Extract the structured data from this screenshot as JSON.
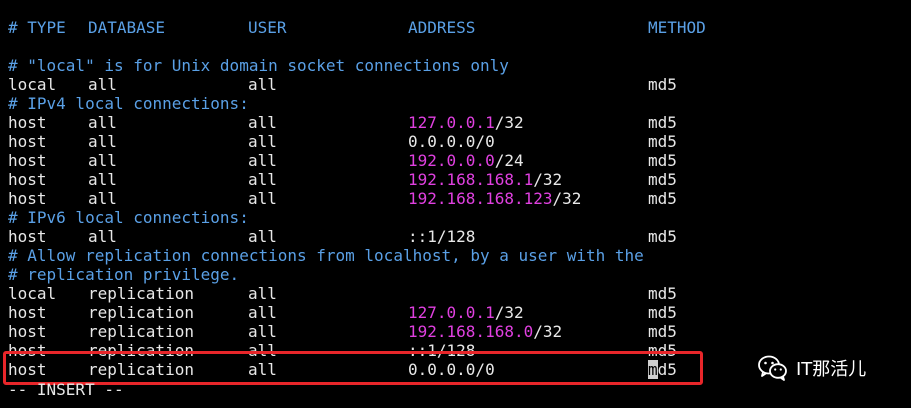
{
  "header": {
    "type": "# TYPE",
    "database": "DATABASE",
    "user": "USER",
    "address": "ADDRESS",
    "method": "METHOD"
  },
  "lines": [
    {
      "kind": "blank"
    },
    {
      "kind": "comment",
      "text": "# \"local\" is for Unix domain socket connections only"
    },
    {
      "kind": "entry",
      "type": "local",
      "database": "all",
      "user": "all",
      "address_ip": "",
      "address_suffix": "",
      "method": "md5"
    },
    {
      "kind": "comment",
      "text": "# IPv4 local connections:"
    },
    {
      "kind": "entry",
      "type": "host",
      "database": "all",
      "user": "all",
      "address_ip": "127.0.0.1",
      "address_suffix": "/32",
      "method": "md5"
    },
    {
      "kind": "entry",
      "type": "host",
      "database": "all",
      "user": "all",
      "address_plain": "0.0.0.0/0",
      "method": "md5"
    },
    {
      "kind": "entry",
      "type": "host",
      "database": "all",
      "user": "all",
      "address_ip": "192.0.0.0",
      "address_suffix": "/24",
      "method": "md5"
    },
    {
      "kind": "entry",
      "type": "host",
      "database": "all",
      "user": "all",
      "address_ip": "192.168.168.1",
      "address_suffix": "/32",
      "method": "md5"
    },
    {
      "kind": "entry",
      "type": "host",
      "database": "all",
      "user": "all",
      "address_ip": "192.168.168.123",
      "address_suffix": "/32",
      "method": "md5"
    },
    {
      "kind": "comment",
      "text": "# IPv6 local connections:"
    },
    {
      "kind": "entry",
      "type": "host",
      "database": "all",
      "user": "all",
      "address_plain": "::1/128",
      "method": "md5"
    },
    {
      "kind": "comment",
      "text": "# Allow replication connections from localhost, by a user with the"
    },
    {
      "kind": "comment",
      "text": "# replication privilege."
    },
    {
      "kind": "entry",
      "type": "local",
      "database": "replication",
      "user": "all",
      "address_ip": "",
      "address_suffix": "",
      "method": "md5"
    },
    {
      "kind": "entry",
      "type": "host",
      "database": "replication",
      "user": "all",
      "address_ip": "127.0.0.1",
      "address_suffix": "/32",
      "method": "md5"
    },
    {
      "kind": "entry",
      "type": "host",
      "database": "replication",
      "user": "all",
      "address_ip": "192.168.168.0",
      "address_suffix": "/32",
      "method": "md5"
    },
    {
      "kind": "entry",
      "type": "host",
      "database": "replication",
      "user": "all",
      "address_plain": "::1/128",
      "method": "md5"
    },
    {
      "kind": "entry",
      "type": "host",
      "database": "replication",
      "user": "all",
      "address_plain": "0.0.0.0/0",
      "method_cursor": "m",
      "method_rest": "d5",
      "highlighted": true
    }
  ],
  "status": "-- INSERT --",
  "watermark": {
    "label": "IT那活儿",
    "icon": "wechat-icon"
  },
  "colors": {
    "background": "#000000",
    "text": "#e8e8e8",
    "comment": "#5aa0e6",
    "ip": "#e040e0",
    "highlight_border": "#e8262a"
  }
}
